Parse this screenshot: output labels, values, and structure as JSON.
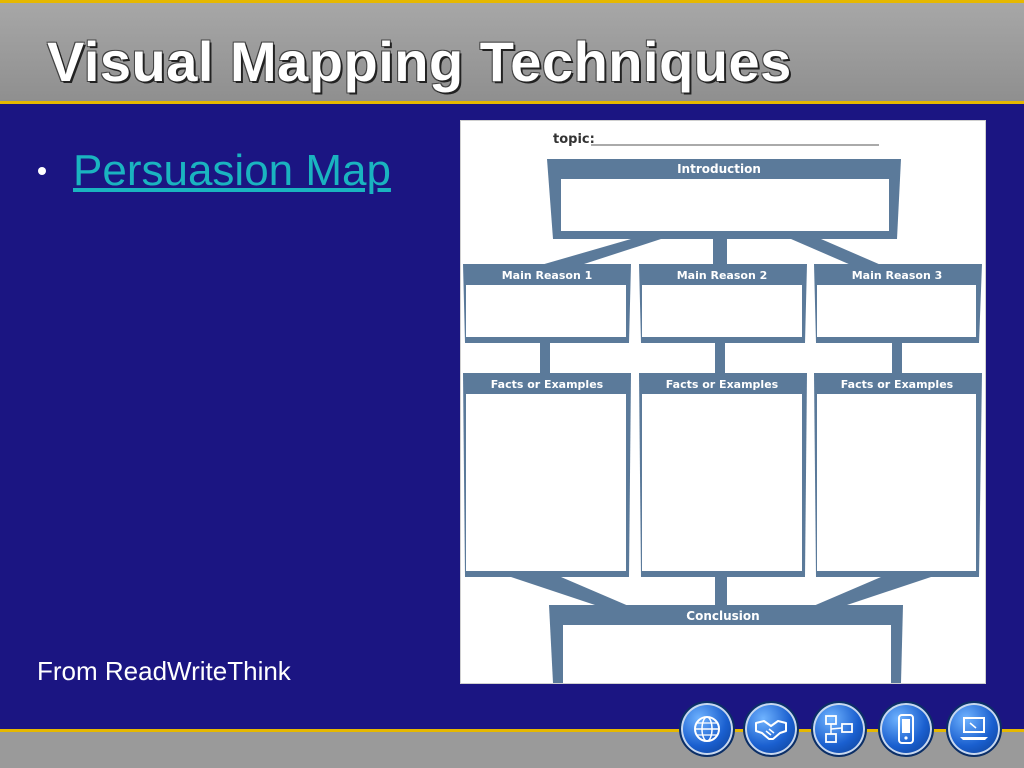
{
  "slide": {
    "title": "Visual Mapping Techniques",
    "bullet_link": "Persuasion Map",
    "source_note": "From ReadWriteThink"
  },
  "worksheet": {
    "topic_label": "topic:",
    "introduction": "Introduction",
    "main_reasons": [
      "Main Reason 1",
      "Main Reason 2",
      "Main Reason 3"
    ],
    "facts": [
      "Facts or Examples",
      "Facts or Examples",
      "Facts or Examples"
    ],
    "conclusion": "Conclusion"
  },
  "footer": {
    "icons": [
      "globe-icon",
      "handshake-icon",
      "network-icon",
      "mobile-phone-icon",
      "laptop-icon"
    ]
  },
  "colors": {
    "background": "#1b1582",
    "title_band": "#9a9a9a",
    "accent_gold": "#e6b800",
    "link": "#1ab4c0",
    "worksheet_frame": "#5b7a9a"
  }
}
